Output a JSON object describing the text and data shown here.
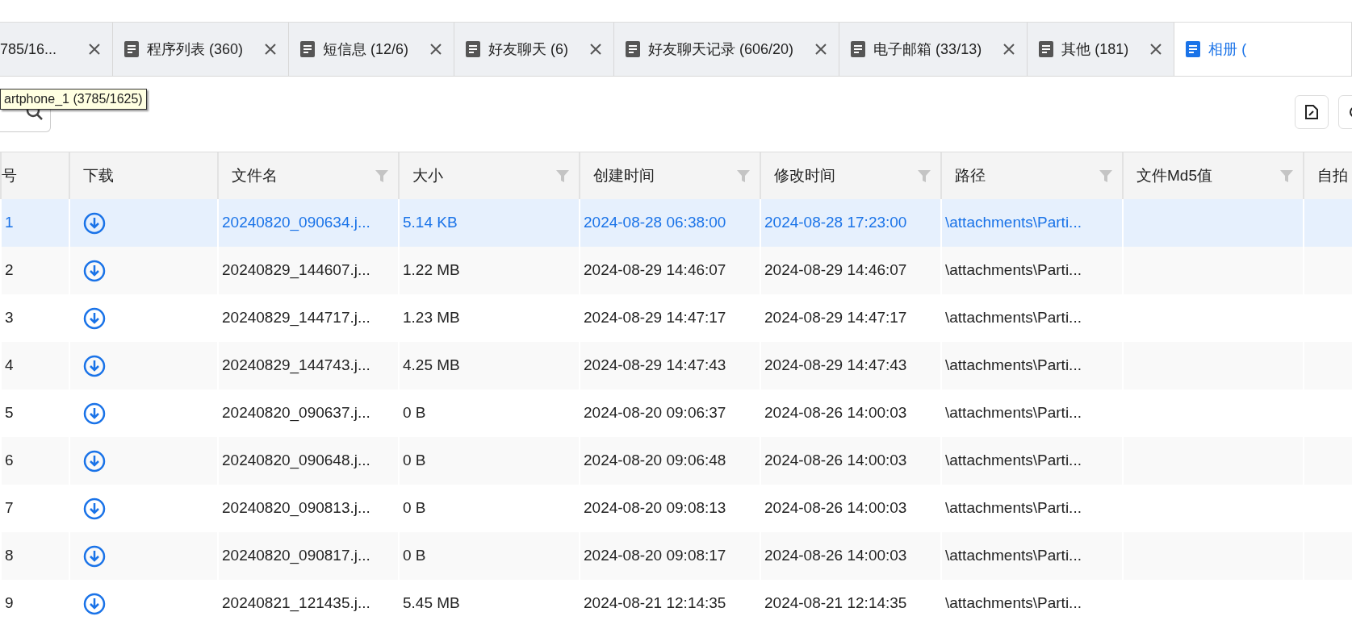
{
  "tabs": [
    {
      "label": "785/16...",
      "selected": false,
      "closable": true
    },
    {
      "label": "程序列表 (360)",
      "selected": false,
      "closable": true
    },
    {
      "label": "短信息 (12/6)",
      "selected": false,
      "closable": true
    },
    {
      "label": "好友聊天 (6)",
      "selected": false,
      "closable": true
    },
    {
      "label": "好友聊天记录 (606/20)",
      "selected": false,
      "closable": true
    },
    {
      "label": "电子邮箱 (33/13)",
      "selected": false,
      "closable": true
    },
    {
      "label": "其他 (181)",
      "selected": false,
      "closable": true
    },
    {
      "label": "相册 (",
      "selected": true,
      "closable": false
    }
  ],
  "tooltip": "artphone_1 (3785/1625)",
  "table": {
    "columns": [
      {
        "label": "号",
        "filter": false
      },
      {
        "label": "下载",
        "filter": false
      },
      {
        "label": "文件名",
        "filter": true
      },
      {
        "label": "大小",
        "filter": true
      },
      {
        "label": "创建时间",
        "filter": true
      },
      {
        "label": "修改时间",
        "filter": true
      },
      {
        "label": "路径",
        "filter": true
      },
      {
        "label": "文件Md5值",
        "filter": true
      },
      {
        "label": "自拍",
        "filter": false
      }
    ],
    "rows": [
      {
        "index": "1",
        "selected": true,
        "file": "20240820_090634.j...",
        "size": "5.14 KB",
        "created": "2024-08-28 06:38:00",
        "modified": "2024-08-28 17:23:00",
        "path": "\\attachments\\Parti..."
      },
      {
        "index": "2",
        "selected": false,
        "file": "20240829_144607.j...",
        "size": "1.22 MB",
        "created": "2024-08-29 14:46:07",
        "modified": "2024-08-29 14:46:07",
        "path": "\\attachments\\Parti..."
      },
      {
        "index": "3",
        "selected": false,
        "file": "20240829_144717.j...",
        "size": "1.23 MB",
        "created": "2024-08-29 14:47:17",
        "modified": "2024-08-29 14:47:17",
        "path": "\\attachments\\Parti..."
      },
      {
        "index": "4",
        "selected": false,
        "file": "20240829_144743.j...",
        "size": "4.25 MB",
        "created": "2024-08-29 14:47:43",
        "modified": "2024-08-29 14:47:43",
        "path": "\\attachments\\Parti..."
      },
      {
        "index": "5",
        "selected": false,
        "file": "20240820_090637.j...",
        "size": "0 B",
        "created": "2024-08-20 09:06:37",
        "modified": "2024-08-26 14:00:03",
        "path": "\\attachments\\Parti..."
      },
      {
        "index": "6",
        "selected": false,
        "file": "20240820_090648.j...",
        "size": "0 B",
        "created": "2024-08-20 09:06:48",
        "modified": "2024-08-26 14:00:03",
        "path": "\\attachments\\Parti..."
      },
      {
        "index": "7",
        "selected": false,
        "file": "20240820_090813.j...",
        "size": "0 B",
        "created": "2024-08-20 09:08:13",
        "modified": "2024-08-26 14:00:03",
        "path": "\\attachments\\Parti..."
      },
      {
        "index": "8",
        "selected": false,
        "file": "20240820_090817.j...",
        "size": "0 B",
        "created": "2024-08-20 09:08:17",
        "modified": "2024-08-26 14:00:03",
        "path": "\\attachments\\Parti..."
      },
      {
        "index": "9",
        "selected": false,
        "file": "20240821_121435.j...",
        "size": "5.45 MB",
        "created": "2024-08-21 12:14:35",
        "modified": "2024-08-21 12:14:35",
        "path": "\\attachments\\Parti..."
      }
    ]
  }
}
